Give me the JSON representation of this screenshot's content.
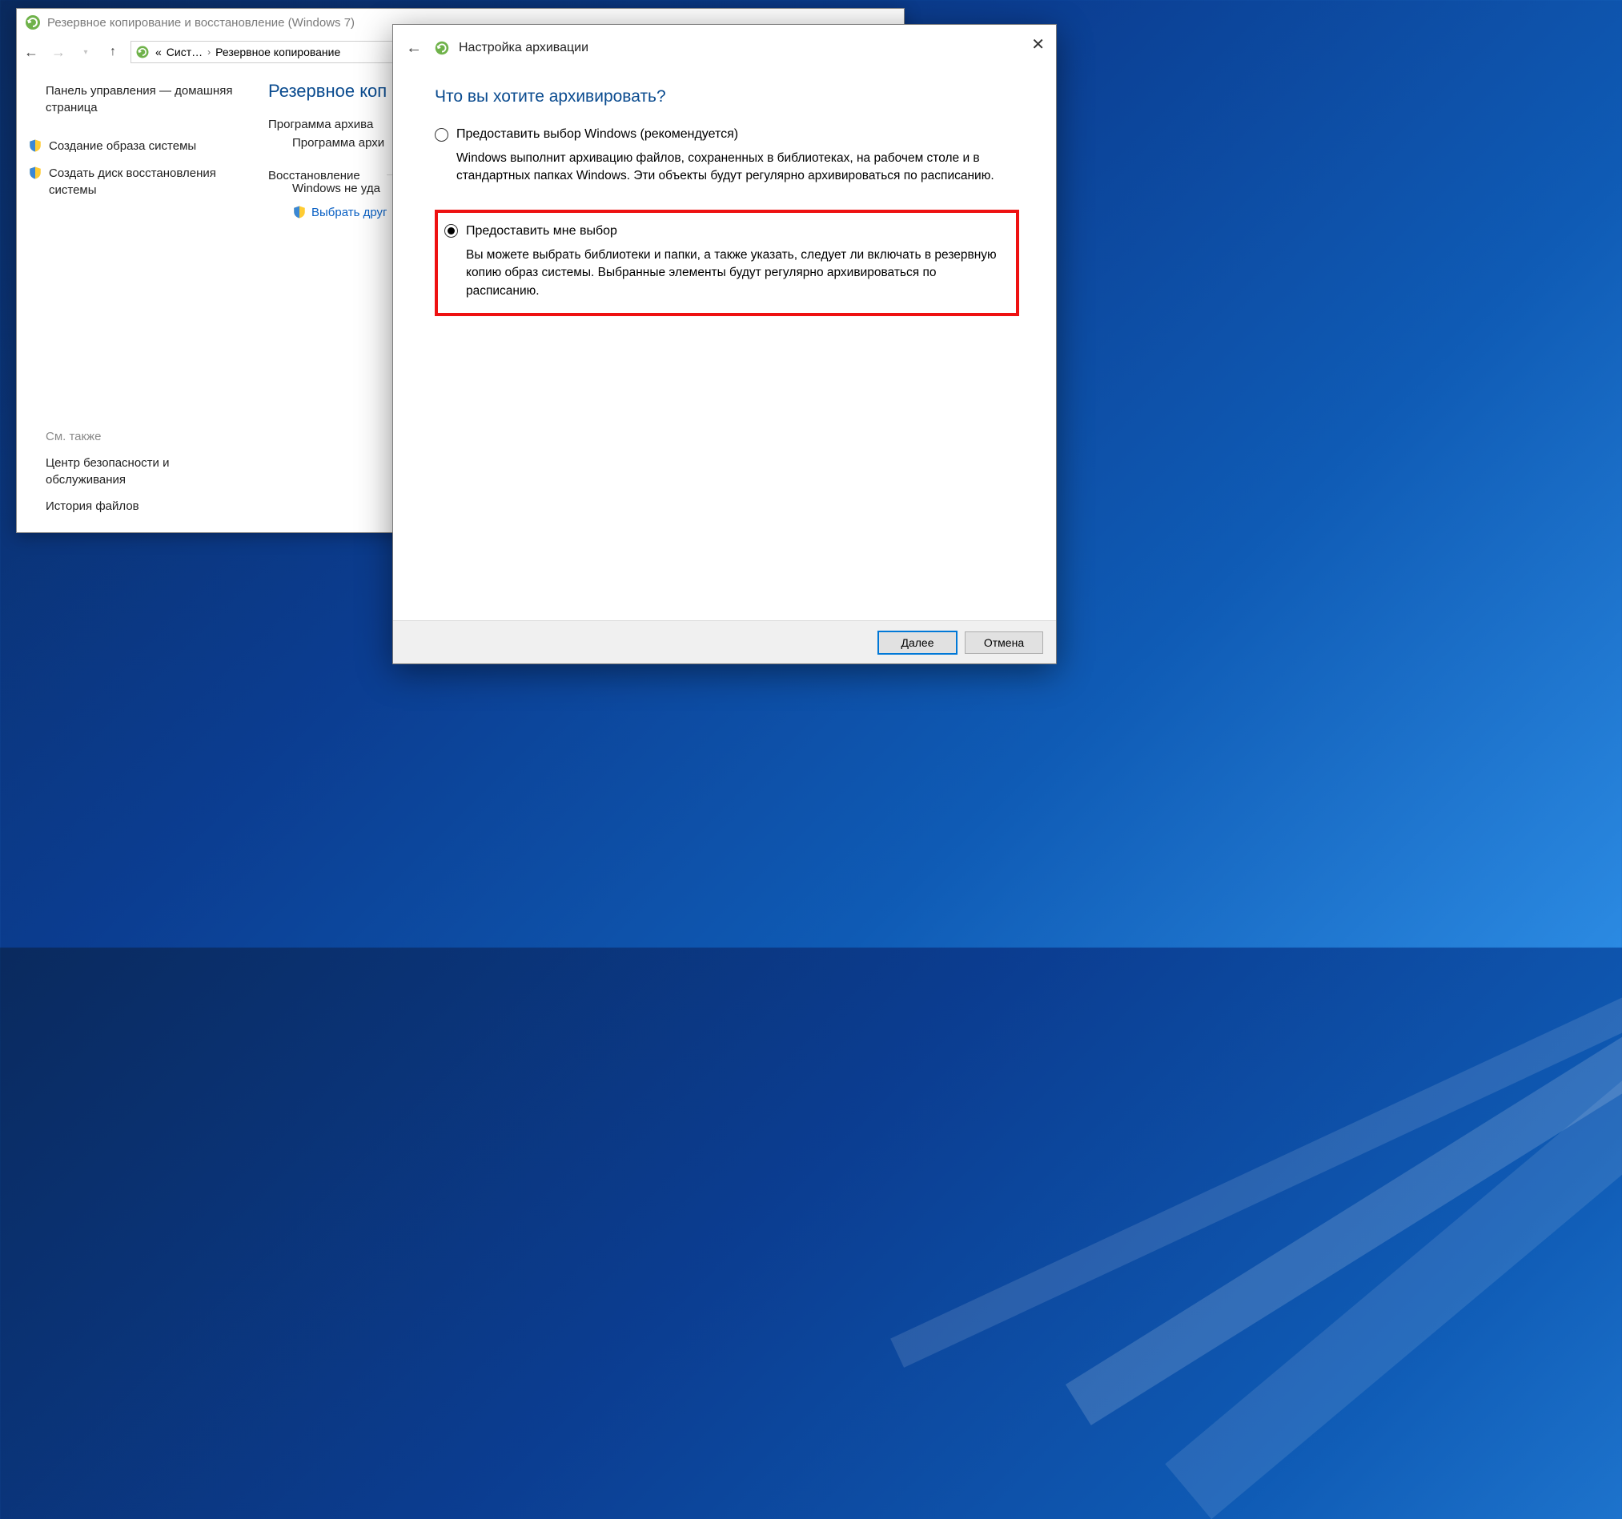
{
  "backwin": {
    "title": "Резервное копирование и восстановление (Windows 7)",
    "breadcrumbs": {
      "seg1_pre": "«",
      "seg1": "Сист…",
      "seg2": "Резервное копирование"
    },
    "left": {
      "home": "Панель управления — домашняя страница",
      "task1": "Создание образа системы",
      "task2": "Создать диск восстановления системы",
      "seealso": "См. также",
      "sa1": "Центр безопасности и обслуживания",
      "sa2": "История файлов"
    },
    "right": {
      "h1": "Резервное коп",
      "sub1": "Программа архива",
      "sub2": "Программа архи",
      "sect": "Восстановление",
      "fail": "Windows не уда",
      "action": "Выбрать друг"
    }
  },
  "dialog": {
    "navtitle": "Настройка архивации",
    "heading": "Что вы хотите архивировать?",
    "opt1": {
      "label": "Предоставить выбор Windows (рекомендуется)",
      "desc": "Windows выполнит архивацию файлов, сохраненных в библиотеках, на рабочем столе и в стандартных папках Windows. Эти объекты будут регулярно архивироваться по расписанию."
    },
    "opt2": {
      "label": "Предоставить мне выбор",
      "desc": "Вы можете выбрать библиотеки и папки, а также указать, следует ли включать в резервную копию образ системы. Выбранные элементы будут регулярно архивироваться по расписанию."
    },
    "buttons": {
      "next": "Далее",
      "cancel": "Отмена"
    }
  }
}
